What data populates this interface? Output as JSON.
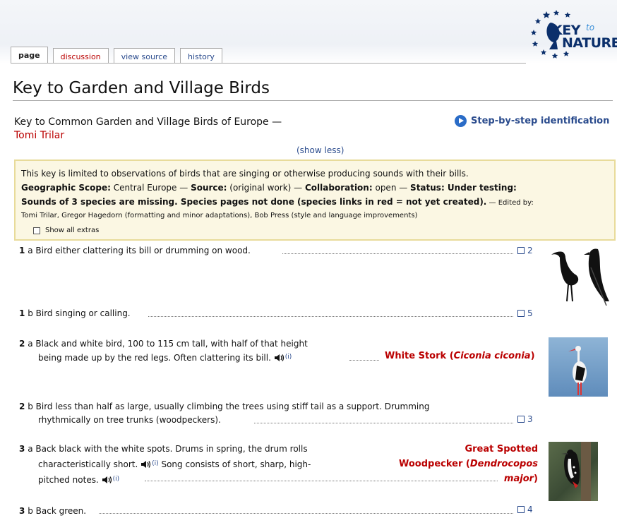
{
  "tabs": [
    {
      "label": "page",
      "state": "active"
    },
    {
      "label": "discussion",
      "state": "missing"
    },
    {
      "label": "view source",
      "state": "normal"
    },
    {
      "label": "history",
      "state": "normal"
    }
  ],
  "logo": {
    "line1": "KEY",
    "to": "to",
    "line2": "NATURE"
  },
  "page_title": "Key to Garden and Village Birds",
  "subtitle": {
    "text": "Key to Common Garden and Village Birds of Europe —",
    "author": "Tomi Trilar"
  },
  "step_by_step": "Step-by-step identification",
  "show_less": "(show less)",
  "info": {
    "intro": "This key is limited to observations of birds that are singing or otherwise producing sounds with their bills.",
    "geo_label": "Geographic Scope:",
    "geo_value": " Central Europe — ",
    "source_label": "Source:",
    "source_value": " (original work) — ",
    "collab_label": "Collaboration:",
    "collab_value": " open — ",
    "status_label": "Status: Under testing:",
    "status_note": "Sounds of 3 species are missing. Species pages not done (species links in red = not yet created).",
    "edited_by": " — Edited by:",
    "editors": "Tomi Trilar, Gregor Hagedorn (formatting and minor adaptations), Bob Press (style and language improvements)",
    "show_all_extras": "Show all extras"
  },
  "couplets": [
    {
      "num": "1",
      "letter": "a",
      "line1": "Bird either clattering its bill or drumming on wood.",
      "lead": "2"
    },
    {
      "num": "1",
      "letter": "b",
      "line1": "Bird singing or calling.",
      "lead": "5"
    },
    {
      "num": "2",
      "letter": "a",
      "line1": "Black and white bird, 100 to 115 cm tall, with half of that height",
      "line2": "being made up by the red legs. Often clattering its bill.",
      "result": "White Stork",
      "result_latin": "Ciconia ciconia"
    },
    {
      "num": "2",
      "letter": "b",
      "line1": "Bird less than half as large, usually climbing the trees using stiff tail as a support. Drumming",
      "line2": "rhythmically on tree trunks (woodpeckers).",
      "lead": "3"
    },
    {
      "num": "3",
      "letter": "a",
      "line1": "Back black with the white spots. Drums in spring, the drum rolls",
      "line2a": "characteristically short.",
      "line2b": "Song consists of short, sharp, high-",
      "line3": "pitched notes.",
      "result_a": "Great Spotted",
      "result_b": "Woodpecker (",
      "result_latin_a": "Dendrocopos",
      "result_latin_b": "major",
      "result_end": ")"
    },
    {
      "num": "3",
      "letter": "b",
      "line1": "Back green.",
      "lead": "4"
    }
  ],
  "info_marker": "(i)",
  "colors": {
    "link": "#2a4b8d",
    "new_link": "#ba0000",
    "infobox_bg": "#fbf7e3",
    "infobox_border": "#e8db9a"
  }
}
